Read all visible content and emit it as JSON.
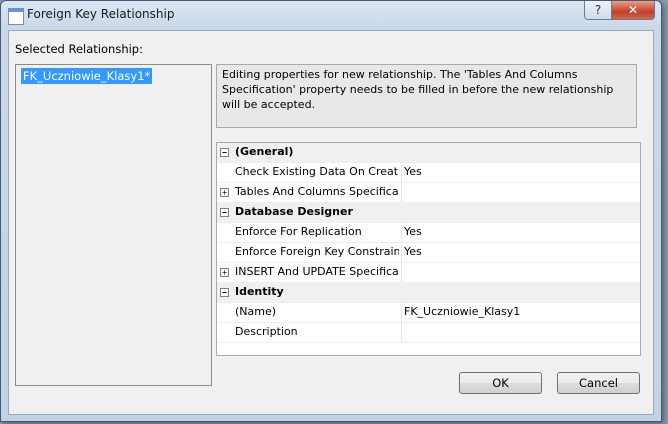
{
  "window": {
    "title": "Foreign Key Relationship",
    "help_glyph": "?",
    "close_glyph": "✕"
  },
  "selected_relationship_label": "Selected Relationship:",
  "relationships": [
    "FK_Uczniowie_Klasy1*"
  ],
  "description": "Editing properties for new relationship.  The 'Tables And Columns Specification' property needs to be filled in before the new relationship will be accepted.",
  "grid": {
    "rows": [
      {
        "type": "category",
        "toggle": "−",
        "name": "(General)"
      },
      {
        "type": "prop",
        "toggle": "",
        "name": "Check Existing Data On Creatio",
        "value": "Yes"
      },
      {
        "type": "prop",
        "toggle": "+",
        "name": "Tables And Columns Specificat",
        "value": ""
      },
      {
        "type": "category",
        "toggle": "−",
        "name": "Database Designer"
      },
      {
        "type": "prop",
        "toggle": "",
        "name": "Enforce For Replication",
        "value": "Yes"
      },
      {
        "type": "prop",
        "toggle": "",
        "name": "Enforce Foreign Key Constraint",
        "value": "Yes"
      },
      {
        "type": "prop",
        "toggle": "+",
        "name": "INSERT And UPDATE Specificat",
        "value": ""
      },
      {
        "type": "category",
        "toggle": "−",
        "name": "Identity"
      },
      {
        "type": "prop",
        "toggle": "",
        "name": "(Name)",
        "value": "FK_Uczniowie_Klasy1"
      },
      {
        "type": "prop",
        "toggle": "",
        "name": "Description",
        "value": ""
      }
    ]
  },
  "buttons": {
    "ok": "OK",
    "cancel": "Cancel"
  }
}
